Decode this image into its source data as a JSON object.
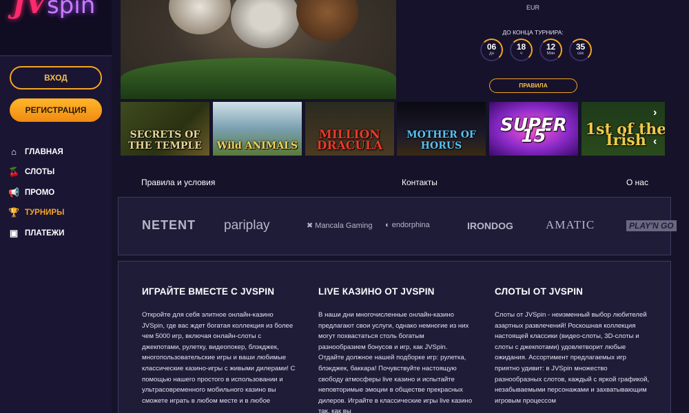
{
  "logo": {
    "jv": "JV",
    "spin": "spin"
  },
  "sidebar": {
    "login_label": "ВХОД",
    "register_label": "РЕГИСТРАЦИЯ",
    "items": [
      {
        "label": "ГЛАВНАЯ",
        "icon": "home-icon"
      },
      {
        "label": "СЛОТЫ",
        "icon": "cherries-icon"
      },
      {
        "label": "ПРОМО",
        "icon": "megaphone-icon"
      },
      {
        "label": "ТУРНИРЫ",
        "icon": "trophy-icon",
        "active": true
      },
      {
        "label": "ПЛАТЕЖИ",
        "icon": "wallet-icon"
      }
    ]
  },
  "tournament": {
    "currency": "EUR",
    "until_label": "ДО КОНЦА ТУРНИРА:",
    "timer": [
      {
        "value": "06",
        "unit": "дн"
      },
      {
        "value": "18",
        "unit": "ч"
      },
      {
        "value": "12",
        "unit": "Мин"
      },
      {
        "value": "35",
        "unit": "сек"
      }
    ],
    "rules_label": "ПРАВИЛА"
  },
  "games": [
    {
      "title": "SECRETS OF THE TEMPLE"
    },
    {
      "title": "Wild ANIMALS"
    },
    {
      "title": "MILLION DRACULA"
    },
    {
      "title": "MOTHER OF HORUS"
    },
    {
      "title": "SUPER 15"
    },
    {
      "title": "1st of the Irish"
    }
  ],
  "footer_links": {
    "terms": "Правила и условия",
    "contacts": "Контакты",
    "about": "О нас"
  },
  "providers": [
    "NETENT",
    "pariplay",
    "Mancala Gaming",
    "endorphina",
    "IRONDOG",
    "AMATIC",
    "PLAY'N GO"
  ],
  "info": [
    {
      "title": "ИГРАЙТЕ ВМЕСТЕ С JVSPIN",
      "text": "Откройте для себя элитное онлайн-казино JVSpin, где вас ждет богатая коллекция из более чем 5000 игр, включая онлайн-слоты с джекпотами, рулетку, видеопокер, блэкджек, многопользовательские игры и ваши любимые классические казино-игры с живыми дилерами! С помощью нашего простого в использовании и ультрасовременного мобильного казино вы сможете играть в любом месте и в любое"
    },
    {
      "title": "LIVE КАЗИНО ОТ JVSPIN",
      "text": "В наши дни многочисленные онлайн-казино предлагают свои услуги, однако немногие из них могут похвастаться столь богатым разнообразием бонусов и игр, как JVSpin. Отдайте должное нашей подборке игр: рулетка, блэкджек, баккара! Почувствуйте настоящую свободу атмосферы live казино и испытайте неповторимые эмоции в обществе прекрасных дилеров. Играйте в классические игры live казино так, как вы"
    },
    {
      "title": "СЛОТЫ ОТ JVSPIN",
      "text": "Слоты от JVSpin - неизменный выбор любителей азартных развлечений! Роскошная коллекция настоящей классики (видео-слоты, 3D-слоты и слоты с джекпотами) удовлетворит любые ожидания. Ассортимент предлагаемых игр приятно удивит: в JVSpin множество разнообразных слотов, каждый с яркой графикой, незабываемыми персонажами и захватывающим игровым процессом"
    }
  ]
}
